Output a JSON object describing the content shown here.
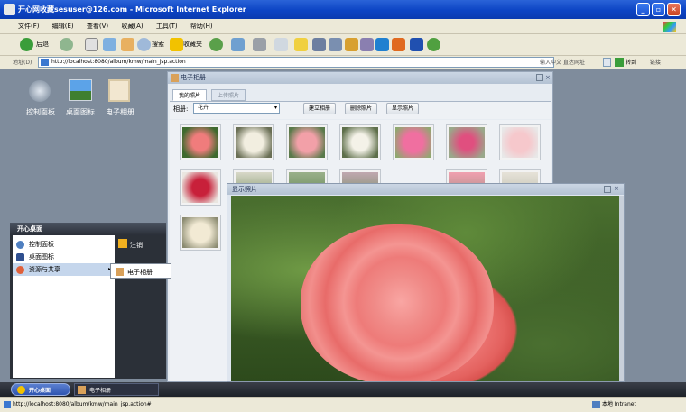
{
  "browser": {
    "title": "开心网收藏sesuser@126.com - Microsoft Internet Explorer",
    "menu": [
      "文件(F)",
      "编辑(E)",
      "查看(V)",
      "收藏(A)",
      "工具(T)",
      "帮助(H)"
    ],
    "back_label": "后退",
    "search_label": "搜索",
    "favorites_label": "收藏夹",
    "address_label": "地址(D)",
    "address_url": "http://localhost:8080/album/kmw/main_jsp.action",
    "search_hint": "输入中文 直达网址",
    "go_label": "转到",
    "links_label": "链接"
  },
  "desktop": {
    "icons": [
      {
        "label": "控制面板",
        "icon": "control-panel-icon"
      },
      {
        "label": "桌面图标",
        "icon": "desktop-icon"
      },
      {
        "label": "电子相册",
        "icon": "album-icon"
      }
    ]
  },
  "album_window": {
    "title": "电子相册",
    "tabs": [
      "我的照片",
      "上传照片"
    ],
    "filter_label": "相册:",
    "filter_value": "花卉",
    "buttons": [
      "建立相册",
      "删除照片",
      "显示照片"
    ],
    "thumbnails": [
      "rose",
      "lily",
      "pink-lily",
      "white-lily",
      "pink-flower",
      "stargazer-lily",
      "pale-pink",
      "red-berries",
      "white-flowers",
      "garden",
      "garden",
      "pink-flowers",
      "white-rose",
      "white-rose-2"
    ]
  },
  "photo_window": {
    "title": "显示照片",
    "photo": "pink-rose"
  },
  "start_menu": {
    "header": "开心桌面",
    "items": [
      {
        "label": "控制面板",
        "icon": "control-panel-icon"
      },
      {
        "label": "桌面图标",
        "icon": "desktop-icon"
      },
      {
        "label": "资源与共享",
        "icon": "share-icon"
      }
    ],
    "logout": "注销",
    "submenu_item": "电子相册"
  },
  "taskbar": {
    "start_label": "开心桌面",
    "task_label": "电子相册"
  },
  "status": {
    "url": "http://localhost:8080/album/kmw/main_jsp.action#",
    "zone": "本地 Intranet"
  },
  "colors": {
    "title_blue": "#0c44c4",
    "desktop": "#7f8c9c",
    "rose": "#f07f80",
    "leaf": "#3f6a2e"
  }
}
